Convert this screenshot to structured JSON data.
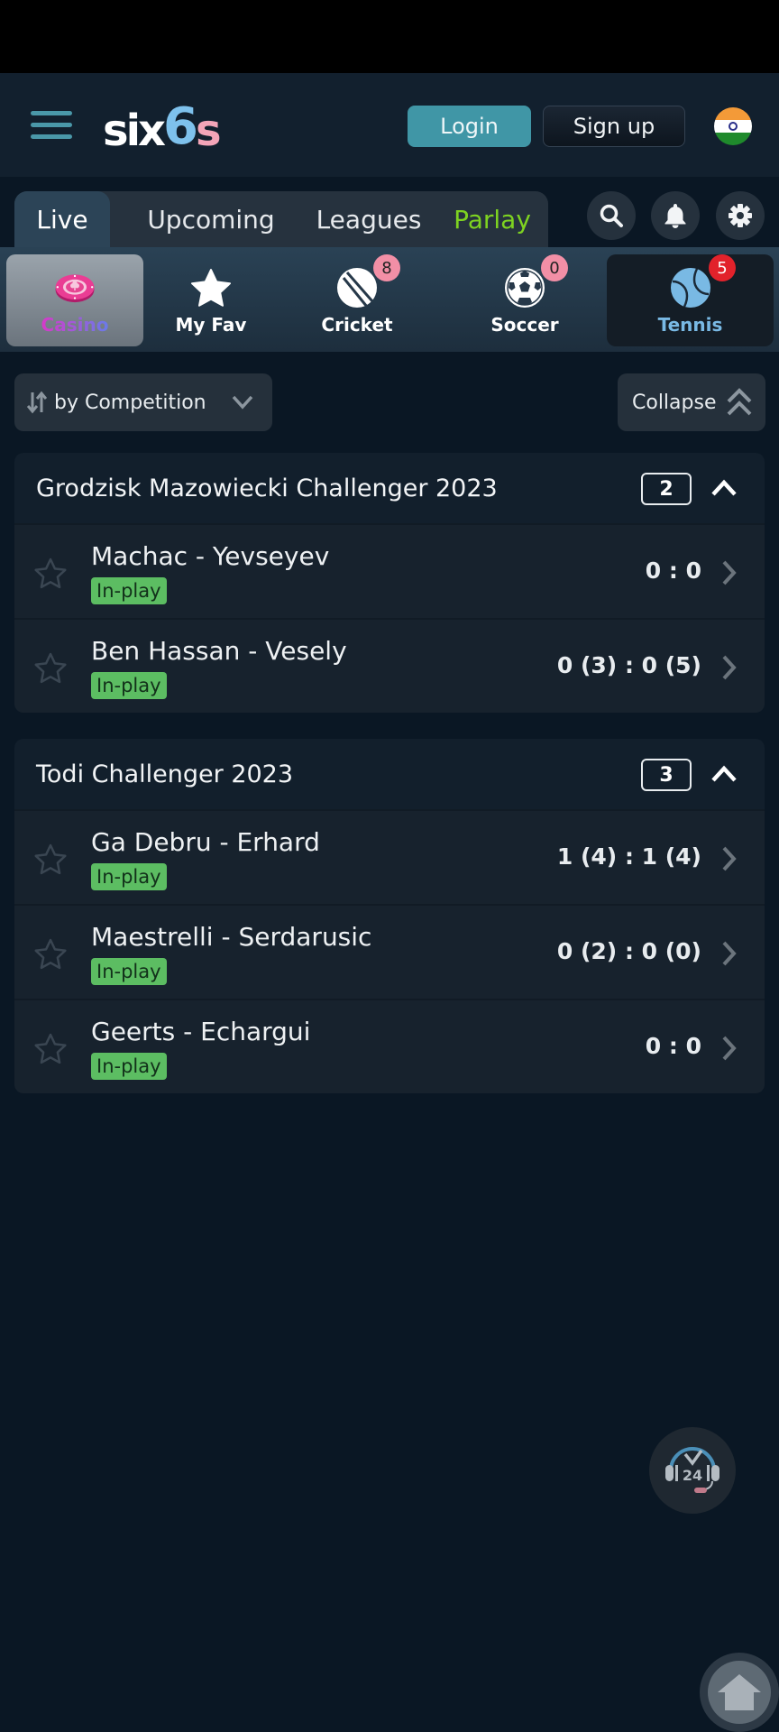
{
  "header": {
    "logo": {
      "part1": "six",
      "part2": "6",
      "part3": "s"
    },
    "login_label": "Login",
    "signup_label": "Sign up",
    "language_flag": "india-flag"
  },
  "nav": {
    "tabs": [
      {
        "label": "Live",
        "active": true
      },
      {
        "label": "Upcoming",
        "active": false
      },
      {
        "label": "Leagues",
        "active": false
      },
      {
        "label": "Parlay",
        "active": false
      }
    ],
    "icons": [
      "search-icon",
      "bell-icon",
      "gear-icon"
    ]
  },
  "sports": [
    {
      "label": "Casino",
      "icon": "casino-chip-icon"
    },
    {
      "label": "My Fav",
      "icon": "star-icon"
    },
    {
      "label": "Cricket",
      "icon": "cricket-ball-icon",
      "badge": "8"
    },
    {
      "label": "Soccer",
      "icon": "soccer-ball-icon",
      "badge": "0"
    },
    {
      "label": "Tennis",
      "icon": "tennis-ball-icon",
      "badge": "5",
      "selected": true
    }
  ],
  "toolbar": {
    "sort_label": "by Competition",
    "collapse_label": "Collapse"
  },
  "competitions": [
    {
      "title": "Grodzisk Mazowiecki Challenger 2023",
      "count": "2",
      "matches": [
        {
          "teams": "Machac - Yevseyev",
          "status": "In-play",
          "score": "0 : 0"
        },
        {
          "teams": "Ben Hassan - Vesely",
          "status": "In-play",
          "score": "0 (3) : 0 (5)"
        }
      ]
    },
    {
      "title": "Todi Challenger 2023",
      "count": "3",
      "matches": [
        {
          "teams": "Ga Debru - Erhard",
          "status": "In-play",
          "score": "1 (4) : 1 (4)"
        },
        {
          "teams": "Maestrelli - Serdarusic",
          "status": "In-play",
          "score": "0 (2) : 0 (0)"
        },
        {
          "teams": "Geerts - Echargui",
          "status": "In-play",
          "score": "0 : 0"
        }
      ]
    }
  ],
  "floating": {
    "support_label": "24",
    "support_icon": "support-24-headset-icon",
    "home_icon": "home-icon"
  },
  "colors": {
    "accent_teal": "#4096a6",
    "parlay_green": "#7ed321",
    "inplay_green": "#5cbd62",
    "tennis_blue": "#79b9e4",
    "badge_pink": "#f28fa6",
    "badge_red": "#e2222b"
  }
}
